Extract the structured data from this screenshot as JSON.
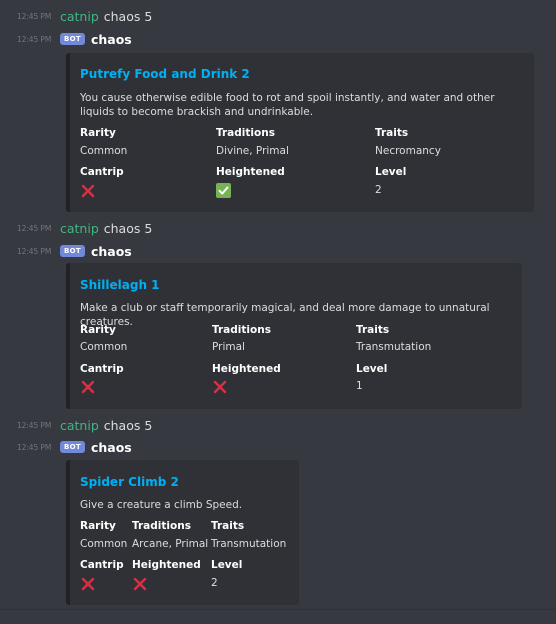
{
  "user": {
    "name": "catnip"
  },
  "bot": {
    "name": "chaos",
    "tag": "BOT"
  },
  "colors": {
    "background": "#36393f",
    "embed_background": "#2f3136",
    "embed_border": "#202225",
    "title": "#00b0f4",
    "username": "#43b581",
    "bot_tag": "#7289da",
    "cross": "#dd2e44",
    "check": "#77b255"
  },
  "messages": [
    {
      "command": {
        "timestamp": "12:45 PM",
        "text": "chaos 5"
      },
      "reply": {
        "timestamp": "12:45 PM",
        "embed": {
          "title": "Putrefy Food and Drink 2",
          "description": "You cause otherwise edible food to rot and spoil instantly, and water and other liquids to become brackish and undrinkable.",
          "fields": {
            "rarity": {
              "name": "Rarity",
              "value": "Common"
            },
            "traditions": {
              "name": "Traditions",
              "value": "Divine, Primal"
            },
            "traits": {
              "name": "Traits",
              "value": "Necromancy"
            },
            "cantrip": {
              "name": "Cantrip",
              "icon": "cross-mark-icon"
            },
            "heightened": {
              "name": "Heightened",
              "icon": "check-mark-icon"
            },
            "level": {
              "name": "Level",
              "value": "2"
            }
          }
        }
      }
    },
    {
      "command": {
        "timestamp": "12:45 PM",
        "text": "chaos 5"
      },
      "reply": {
        "timestamp": "12:45 PM",
        "embed": {
          "title": "Shillelagh 1",
          "description": "Make a club or staff temporarily magical, and deal more damage to unnatural creatures.",
          "fields": {
            "rarity": {
              "name": "Rarity",
              "value": "Common"
            },
            "traditions": {
              "name": "Traditions",
              "value": "Primal"
            },
            "traits": {
              "name": "Traits",
              "value": "Transmutation"
            },
            "cantrip": {
              "name": "Cantrip",
              "icon": "cross-mark-icon"
            },
            "heightened": {
              "name": "Heightened",
              "icon": "cross-mark-icon"
            },
            "level": {
              "name": "Level",
              "value": "1"
            }
          }
        }
      }
    },
    {
      "command": {
        "timestamp": "12:45 PM",
        "text": "chaos 5"
      },
      "reply": {
        "timestamp": "12:45 PM",
        "embed": {
          "title": "Spider Climb 2",
          "description": "Give a creature a climb Speed.",
          "fields": {
            "rarity": {
              "name": "Rarity",
              "value": "Common"
            },
            "traditions": {
              "name": "Traditions",
              "value": "Arcane, Primal"
            },
            "traits": {
              "name": "Traits",
              "value": "Transmutation"
            },
            "cantrip": {
              "name": "Cantrip",
              "icon": "cross-mark-icon"
            },
            "heightened": {
              "name": "Heightened",
              "icon": "cross-mark-icon"
            },
            "level": {
              "name": "Level",
              "value": "2"
            }
          }
        }
      }
    }
  ]
}
